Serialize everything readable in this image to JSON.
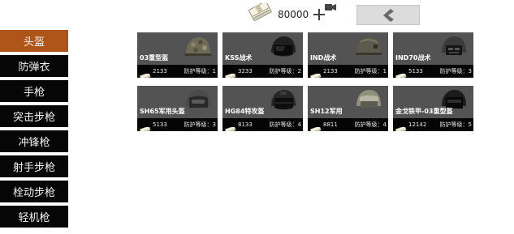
{
  "header": {
    "money": "80000",
    "cash_icon": "cash-stack-icon",
    "add_icon": "plus-video-icon",
    "back_icon": "chevron-left-icon"
  },
  "categories": [
    {
      "label": "头盔",
      "active": true
    },
    {
      "label": "防弹衣",
      "active": false
    },
    {
      "label": "手枪",
      "active": false
    },
    {
      "label": "突击步枪",
      "active": false
    },
    {
      "label": "冲锋枪",
      "active": false
    },
    {
      "label": "射手步枪",
      "active": false
    },
    {
      "label": "栓动步枪",
      "active": false
    },
    {
      "label": "轻机枪",
      "active": false
    }
  ],
  "items": [
    {
      "name": "03重型盔",
      "price": "2133",
      "level": "防护等级：1"
    },
    {
      "name": "KSS战术",
      "price": "3233",
      "level": "防护等级：2"
    },
    {
      "name": "IND战术",
      "price": "2133",
      "level": "防护等级：1"
    },
    {
      "name": "IND70战术",
      "price": "5133",
      "level": "防护等级：3"
    },
    {
      "name": "SH65军用头盔",
      "price": "5133",
      "level": "防护等级：3"
    },
    {
      "name": "HG84特攻盔",
      "price": "8133",
      "level": "防护等级：4"
    },
    {
      "name": "SH12军用",
      "price": "8811",
      "level": "防护等级：4"
    },
    {
      "name": "金戈铁甲-03重型盔",
      "price": "12142",
      "level": "防护等级：5"
    }
  ],
  "colors": {
    "active_category": "#b05519",
    "category_bg": "#060606",
    "card_bg": "#535353",
    "card_footer": "#050505"
  }
}
